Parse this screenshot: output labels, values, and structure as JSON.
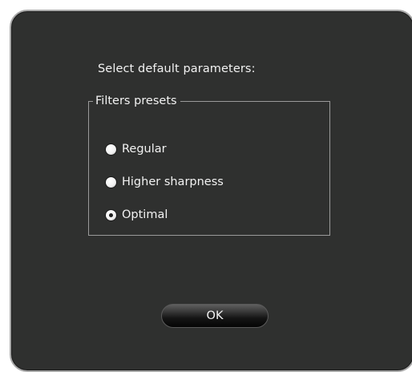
{
  "dialog": {
    "prompt": "Select default parameters:",
    "group": {
      "legend": "Filters presets",
      "options": [
        {
          "label": "Regular",
          "selected": false
        },
        {
          "label": "Higher sharpness",
          "selected": false
        },
        {
          "label": "Optimal",
          "selected": true
        }
      ]
    },
    "ok_label": "OK"
  },
  "colors": {
    "background": "#2f302f",
    "text": "#f2f2f2",
    "border": "#9a9a9a"
  }
}
